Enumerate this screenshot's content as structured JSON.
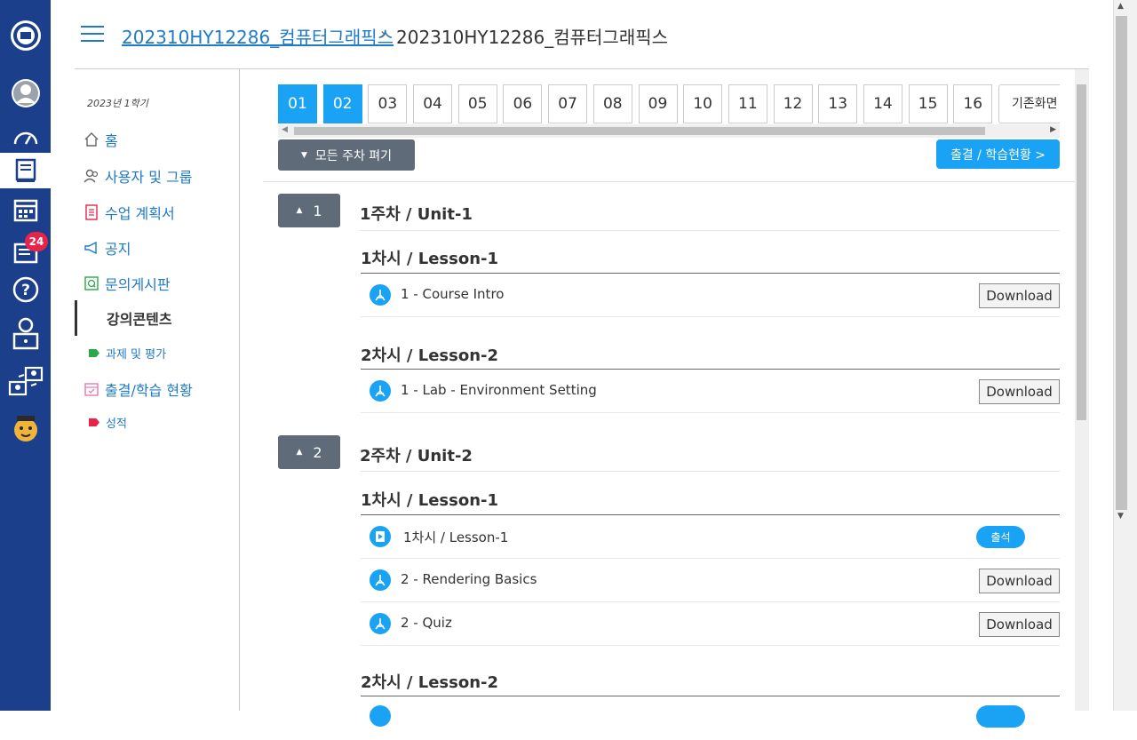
{
  "rail": {
    "badge_count": "24",
    "items": [
      {
        "name": "university-logo-icon"
      },
      {
        "name": "profile-icon"
      },
      {
        "name": "dashboard-icon"
      },
      {
        "name": "courses-icon"
      },
      {
        "name": "calendar-icon"
      },
      {
        "name": "inbox-icon"
      },
      {
        "name": "help-icon"
      },
      {
        "name": "online-lecture-icon"
      },
      {
        "name": "video-conference-icon"
      },
      {
        "name": "mascot-icon"
      }
    ]
  },
  "header": {
    "breadcrumb_link": "202310HY12286_컴퓨터그래픽스",
    "separator": "›",
    "breadcrumb_current": "202310HY12286_컴퓨터그래픽스"
  },
  "sidebar": {
    "term": "2023년 1학기",
    "items": [
      {
        "label": "홈",
        "icon": "home-icon"
      },
      {
        "label": "사용자 및 그룹",
        "icon": "users-icon"
      },
      {
        "label": "수업 계획서",
        "icon": "syllabus-icon"
      },
      {
        "label": "공지",
        "icon": "megaphone-icon"
      },
      {
        "label": "문의게시판",
        "icon": "qna-icon"
      },
      {
        "label": "강의콘텐츠",
        "icon": ""
      },
      {
        "label": "과제 및 평가",
        "icon": "tag-icon"
      },
      {
        "label": "출결/학습 현황",
        "icon": "attendance-icon"
      },
      {
        "label": "성적",
        "icon": "tag-icon"
      }
    ]
  },
  "weeks": {
    "items": [
      "01",
      "02",
      "03",
      "04",
      "05",
      "06",
      "07",
      "08",
      "09",
      "10",
      "11",
      "12",
      "13",
      "14",
      "15",
      "16"
    ],
    "selected": [
      "01",
      "02"
    ],
    "home_label": "기존화면"
  },
  "actions": {
    "expand_all": "모든 주차 펴기",
    "attendance": "출결 / 학습현황 >"
  },
  "units": [
    {
      "number": "1",
      "title": "1주차 / Unit-1",
      "lessons": [
        {
          "title": "1차시 / Lesson-1",
          "rows": [
            {
              "label": "1 - Course Intro",
              "action": "Download"
            }
          ]
        },
        {
          "title": "2차시 / Lesson-2",
          "rows": [
            {
              "label": "1 - Lab - Environment Setting",
              "action": "Download"
            }
          ]
        }
      ]
    },
    {
      "number": "2",
      "title": "2주차 / Unit-2",
      "lessons": [
        {
          "title": "1차시 / Lesson-1",
          "rows": [
            {
              "label": "1차시 / Lesson-1",
              "badge": "출석"
            },
            {
              "label": "2 - Rendering Basics",
              "action": "Download"
            },
            {
              "label": "2 - Quiz",
              "action": "Download"
            }
          ]
        },
        {
          "title": "2차시 / Lesson-2",
          "rows": []
        }
      ]
    }
  ],
  "colors": {
    "rail": "#1b3f8a",
    "accent": "#1aa3f5",
    "link": "#1f7ac7",
    "button_dark": "#5f6b78",
    "badge_red": "#e8234a"
  }
}
